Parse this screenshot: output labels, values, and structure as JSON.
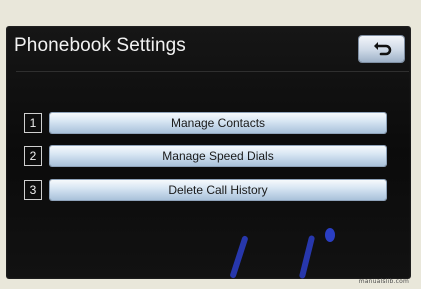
{
  "screen": {
    "title": "Phonebook Settings"
  },
  "header": {
    "back_icon": "return-arrow-icon"
  },
  "menu": {
    "items": [
      {
        "number": "1",
        "label": "Manage Contacts"
      },
      {
        "number": "2",
        "label": "Manage Speed Dials"
      },
      {
        "number": "3",
        "label": "Delete Call History"
      }
    ]
  },
  "colors": {
    "screen_bg": "#111111",
    "button_top": "#f6f9fc",
    "button_bottom": "#a9c1da",
    "text_light": "#f2f2f2",
    "text_dark": "#1a1a1a"
  },
  "watermark": "manualslib.com"
}
